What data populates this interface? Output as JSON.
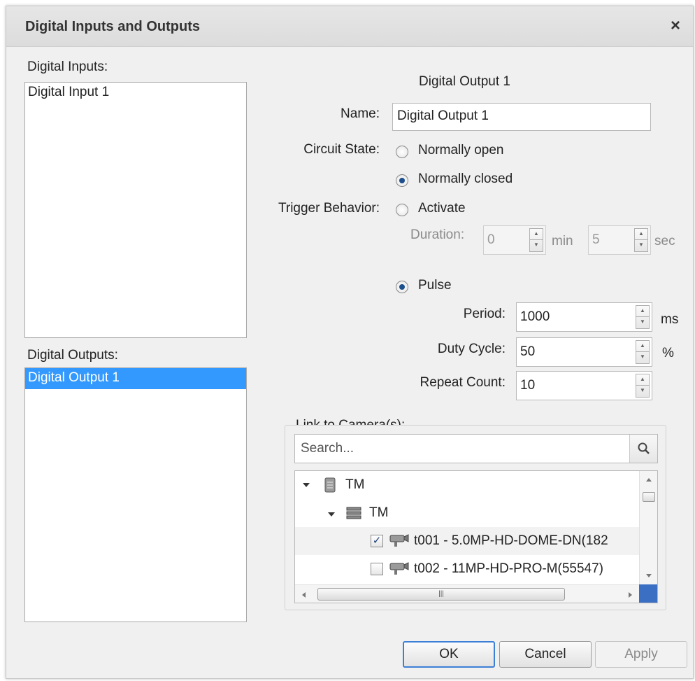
{
  "window": {
    "title": "Digital Inputs and Outputs",
    "close_glyph": "×"
  },
  "inputs": {
    "label": "Digital Inputs:",
    "items": [
      "Digital Input 1"
    ]
  },
  "outputs": {
    "label": "Digital Outputs:",
    "items": [
      "Digital Output 1"
    ],
    "selected_index": 0
  },
  "detail": {
    "heading": "Digital Output 1",
    "name_label": "Name:",
    "name_value": "Digital Output 1",
    "circuit_label": "Circuit State:",
    "circuit_options": [
      "Normally open",
      "Normally closed"
    ],
    "circuit_selected": "Normally closed",
    "trigger_label": "Trigger Behavior:",
    "activate_label": "Activate",
    "duration_label": "Duration:",
    "duration_min": "0",
    "min_unit": "min",
    "duration_sec": "5",
    "sec_unit": "sec",
    "pulse_label": "Pulse",
    "trigger_selected": "Pulse",
    "period_label": "Period:",
    "period_value": "1000",
    "period_unit": "ms",
    "duty_label": "Duty Cycle:",
    "duty_value": "50",
    "duty_unit": "%",
    "repeat_label": "Repeat Count:",
    "repeat_value": "10"
  },
  "link": {
    "label": "Link to Camera(s):",
    "search_placeholder": "Search...",
    "tree": [
      {
        "text": "TM",
        "level": 0,
        "icon": "server-icon",
        "expanded": true
      },
      {
        "text": "TM",
        "level": 1,
        "icon": "nvr-icon",
        "expanded": true
      },
      {
        "text": "t001 - 5.0MP-HD-DOME-DN(182",
        "level": 2,
        "icon": "camera-icon",
        "checked": true
      },
      {
        "text": "t002 - 11MP-HD-PRO-M(55547)",
        "level": 2,
        "icon": "camera-icon",
        "checked": false
      }
    ]
  },
  "buttons": {
    "ok": "OK",
    "cancel": "Cancel",
    "apply": "Apply"
  },
  "colors": {
    "selection": "#3399ff",
    "default_button_border": "#3c7fd6",
    "radio_dot": "#1c4f8c"
  }
}
